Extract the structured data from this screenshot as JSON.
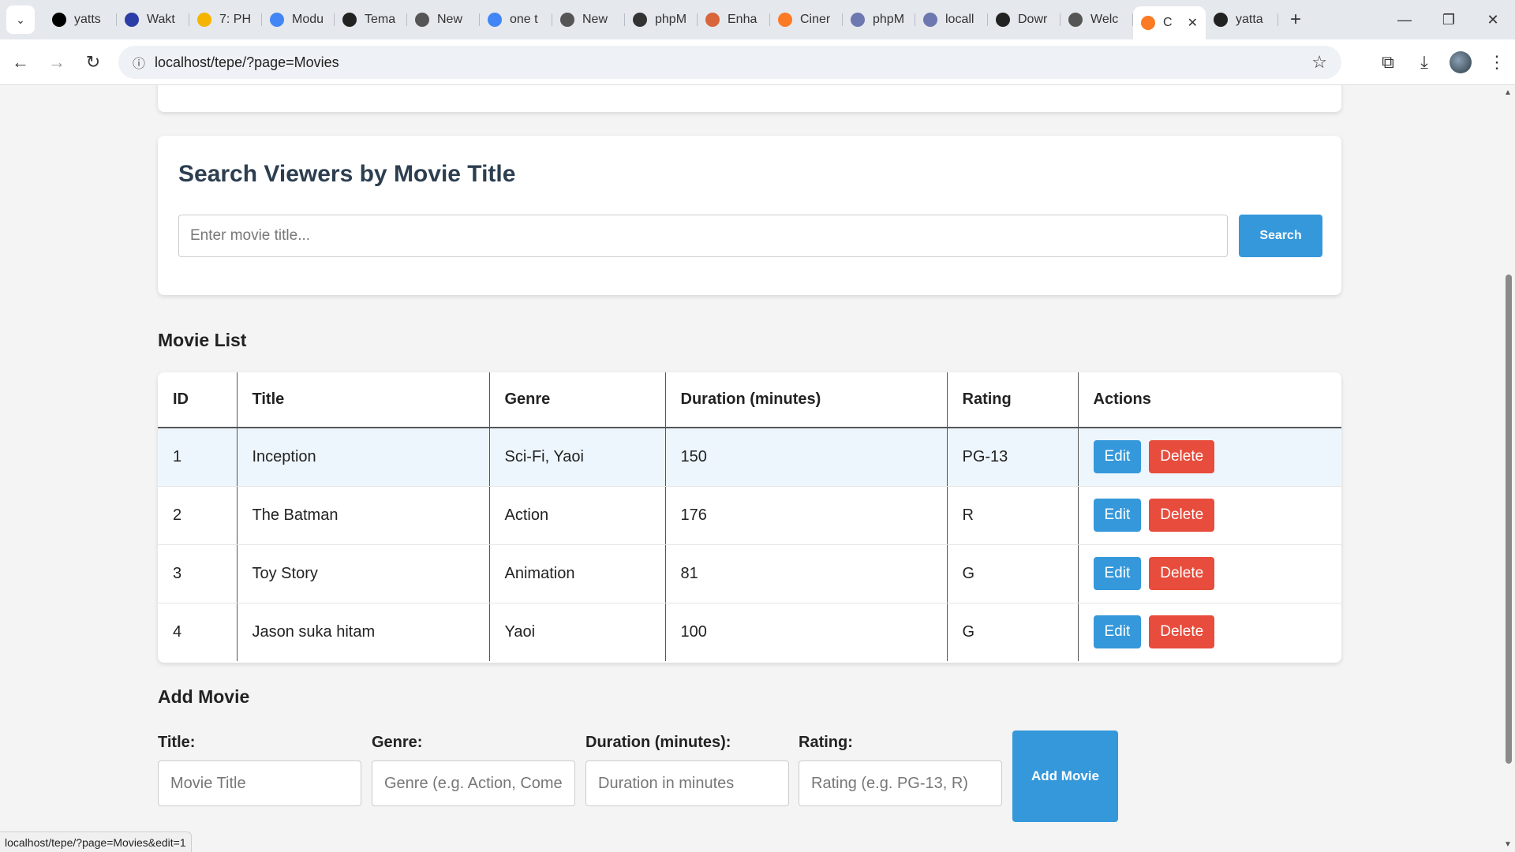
{
  "browser": {
    "tabs": [
      {
        "title": "yatts",
        "icon": "x-icon",
        "color": "#000000"
      },
      {
        "title": "Wakt",
        "icon": "app-icon",
        "color": "#2b3ea8"
      },
      {
        "title": "7: PH",
        "icon": "drive-icon",
        "color": "#f4b400"
      },
      {
        "title": "Modu",
        "icon": "docs-icon",
        "color": "#4285f4"
      },
      {
        "title": "Tema",
        "icon": "openai-icon",
        "color": "#222222"
      },
      {
        "title": "New",
        "icon": "chrome-icon",
        "color": "#555555"
      },
      {
        "title": "one t",
        "icon": "google-icon",
        "color": "#4285f4"
      },
      {
        "title": "New",
        "icon": "chrome-icon",
        "color": "#555555"
      },
      {
        "title": "phpM",
        "icon": "laptop-icon",
        "color": "#333333"
      },
      {
        "title": "Enha",
        "icon": "claude-icon",
        "color": "#d9653b"
      },
      {
        "title": "Ciner",
        "icon": "xampp-icon",
        "color": "#fb7a24"
      },
      {
        "title": "phpM",
        "icon": "pma-icon",
        "color": "#6c78af"
      },
      {
        "title": "locall",
        "icon": "pma-icon",
        "color": "#6c78af"
      },
      {
        "title": "Dowr",
        "icon": "github-icon",
        "color": "#222222"
      },
      {
        "title": "Welc",
        "icon": "chrome-icon",
        "color": "#555555"
      },
      {
        "title": "C",
        "icon": "xampp-icon",
        "color": "#fb7a24",
        "active": true
      },
      {
        "title": "yatta",
        "icon": "github-icon",
        "color": "#222222"
      }
    ],
    "url": "localhost/tepe/?page=Movies",
    "status_url": "localhost/tepe/?page=Movies&edit=1"
  },
  "search": {
    "heading": "Search Viewers by Movie Title",
    "placeholder": "Enter movie title...",
    "button": "Search"
  },
  "movie_list": {
    "heading": "Movie List",
    "columns": [
      "ID",
      "Title",
      "Genre",
      "Duration (minutes)",
      "Rating",
      "Actions"
    ],
    "rows": [
      {
        "id": "1",
        "title": "Inception",
        "genre": "Sci-Fi, Yaoi",
        "duration": "150",
        "rating": "PG-13"
      },
      {
        "id": "2",
        "title": "The Batman",
        "genre": "Action",
        "duration": "176",
        "rating": "R"
      },
      {
        "id": "3",
        "title": "Toy Story",
        "genre": "Animation",
        "duration": "81",
        "rating": "G"
      },
      {
        "id": "4",
        "title": "Jason suka hitam",
        "genre": "Yaoi",
        "duration": "100",
        "rating": "G"
      }
    ],
    "edit_label": "Edit",
    "delete_label": "Delete"
  },
  "add_movie": {
    "heading": "Add Movie",
    "fields": [
      {
        "label": "Title:",
        "placeholder": "Movie Title"
      },
      {
        "label": "Genre:",
        "placeholder": "Genre (e.g. Action, Comedy)"
      },
      {
        "label": "Duration (minutes):",
        "placeholder": "Duration in minutes"
      },
      {
        "label": "Rating:",
        "placeholder": "Rating (e.g. PG-13, R)"
      }
    ],
    "button": "Add Movie"
  },
  "colors": {
    "primary": "#3498db",
    "danger": "#e74c3c",
    "heading": "#2c3e50",
    "row_highlight": "#eef6fd"
  }
}
